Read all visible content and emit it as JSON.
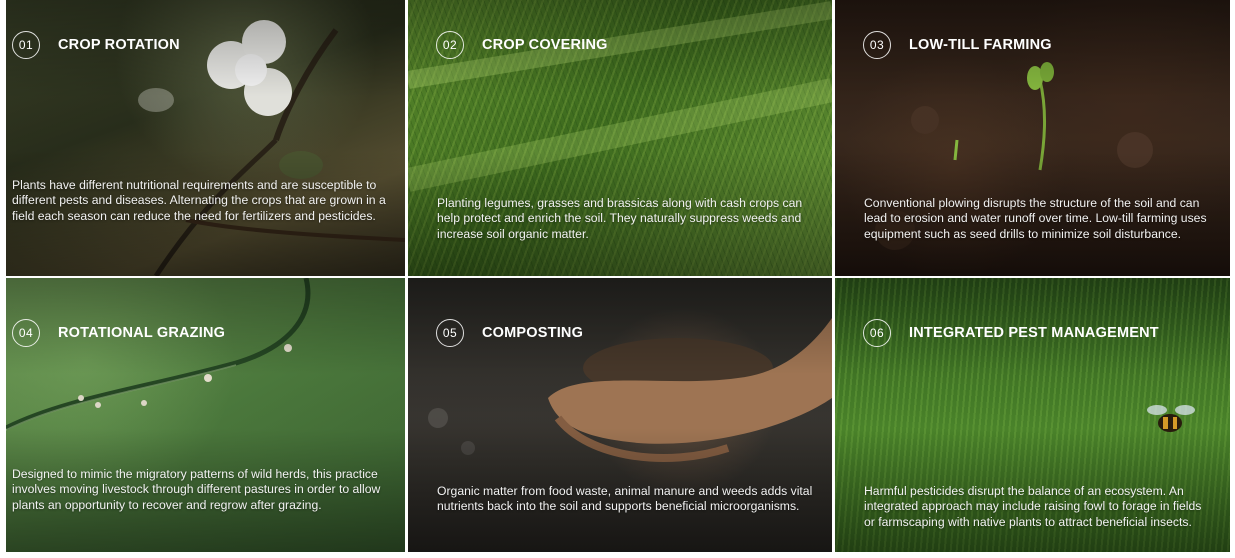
{
  "tiles": [
    {
      "number": "01",
      "title": "CROP ROTATION",
      "description": "Plants have different nutritional requirements and are susceptible to different pests and diseases. Alternating the crops that are grown in a field each season can reduce the need for fertilizers and pesticides."
    },
    {
      "number": "02",
      "title": "CROP COVERING",
      "description": "Planting legumes, grasses and brassicas along with cash crops can help protect and enrich the soil. They naturally suppress weeds and increase soil organic matter."
    },
    {
      "number": "03",
      "title": "LOW-TILL FARMING",
      "description": "Conventional plowing disrupts the structure of the soil and can lead to erosion and water runoff over time. Low-till farming uses equipment such as seed drills to minimize soil disturbance."
    },
    {
      "number": "04",
      "title": "ROTATIONAL GRAZING",
      "description": "Designed to mimic the migratory patterns of wild herds, this practice involves moving livestock through different pastures in order to allow plants an opportunity to recover and regrow after grazing."
    },
    {
      "number": "05",
      "title": "COMPOSTING",
      "description": "Organic matter from food waste, animal manure and weeds adds vital nutrients back into the soil and supports beneficial microorganisms."
    },
    {
      "number": "06",
      "title": "INTEGRATED PEST MANAGEMENT",
      "description": "Harmful pesticides disrupt the balance of an ecosystem. An integrated approach may include raising fowl to forage in fields or farmscaping with native plants to attract beneficial insects."
    }
  ]
}
